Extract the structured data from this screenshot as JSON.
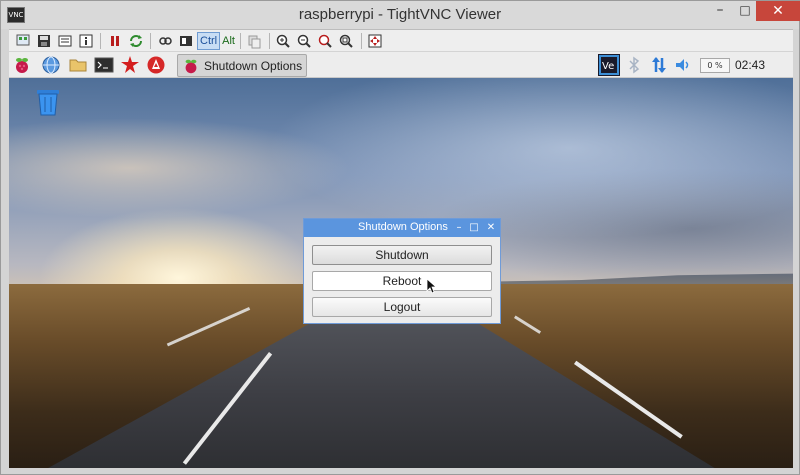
{
  "window": {
    "title": "raspberrypi - TightVNC Viewer",
    "app_icon_text": "VNC",
    "controls": {
      "minimize": "–",
      "maximize": "□",
      "close": "✕"
    }
  },
  "vnc_toolbar": {
    "ctrl_label": "Ctrl",
    "alt_label": "Alt",
    "icons": [
      "new-connection-icon",
      "save-icon",
      "options-icon",
      "info-icon",
      "pause-icon",
      "refresh-icon",
      "send-keys-icon",
      "ctrl-alt-del-icon",
      "copy-icon",
      "zoom-in-icon",
      "zoom-out-icon",
      "zoom-100-icon",
      "zoom-fit-icon",
      "fullscreen-icon"
    ]
  },
  "lx_panel": {
    "task_label": "Shutdown Options",
    "cpu_usage": "0 %",
    "clock": "02:43",
    "launchers": [
      "raspberry-menu-icon",
      "web-browser-icon",
      "file-manager-icon",
      "terminal-icon",
      "mathematica-icon",
      "wolfram-icon"
    ],
    "tray": [
      "vnc-tray-icon",
      "bluetooth-icon",
      "network-icon",
      "volume-icon"
    ]
  },
  "desktop": {
    "icons": [
      "trash-icon"
    ]
  },
  "dialog": {
    "title": "Shutdown Options",
    "controls": {
      "minimize": "–",
      "maximize": "□",
      "close": "✕"
    },
    "buttons": {
      "shutdown": "Shutdown",
      "reboot": "Reboot",
      "logout": "Logout"
    }
  },
  "colors": {
    "dialog_title_bar": "#5b95de",
    "close_button": "#c7463b",
    "panel_bg": "#ededed"
  }
}
